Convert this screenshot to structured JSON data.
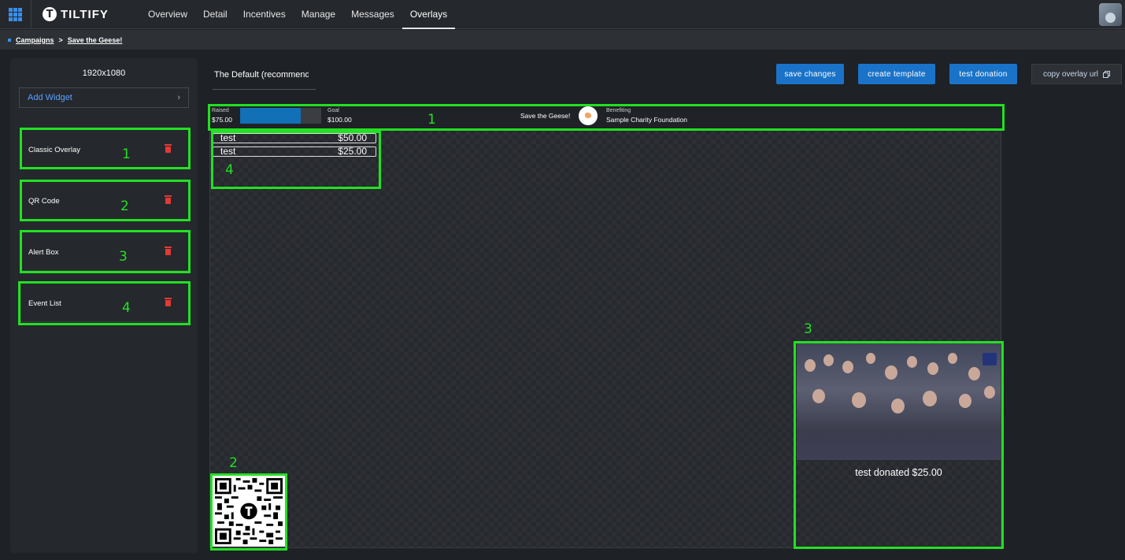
{
  "app": {
    "name": "TILTIFY"
  },
  "nav": {
    "tabs": [
      {
        "label": "Overview"
      },
      {
        "label": "Detail"
      },
      {
        "label": "Incentives"
      },
      {
        "label": "Manage"
      },
      {
        "label": "Messages"
      },
      {
        "label": "Overlays",
        "active": true
      }
    ]
  },
  "breadcrumb": {
    "root": "Campaigns",
    "separator": ">",
    "current": "Save the Geese!"
  },
  "sidebar": {
    "resolution": "1920x1080",
    "add_widget": "Add Widget",
    "add_widget_chevron": "›",
    "widgets": [
      {
        "label": "Classic Overlay",
        "number": "1"
      },
      {
        "label": "QR Code",
        "number": "2"
      },
      {
        "label": "Alert Box",
        "number": "3"
      },
      {
        "label": "Event List",
        "number": "4"
      }
    ]
  },
  "template": {
    "name": "The Default (recommend"
  },
  "toolbar": {
    "save": "save changes",
    "create": "create template",
    "test": "test donation",
    "copy": "copy overlay url",
    "copy_icon": "copy-icon"
  },
  "overlay": {
    "classic": {
      "raised_label": "Raised",
      "raised_value": "$75.00",
      "goal_label": "Goal",
      "goal_value": "$100.00",
      "progress_fraction": 0.75,
      "campaign_name": "Save the Geese!",
      "benefiting_label": "Benefiting",
      "charity": "Sample Charity Foundation"
    },
    "events": [
      {
        "name": "test",
        "amount": "$50.00"
      },
      {
        "name": "test",
        "amount": "$25.00"
      }
    ],
    "alert": {
      "text": "test donated $25.00"
    },
    "annotations": {
      "classic": "1",
      "qr": "2",
      "alert": "3",
      "events": "4"
    }
  },
  "colors": {
    "accent": "#1a73c8",
    "highlight": "#22e022",
    "delete": "#e53935"
  }
}
